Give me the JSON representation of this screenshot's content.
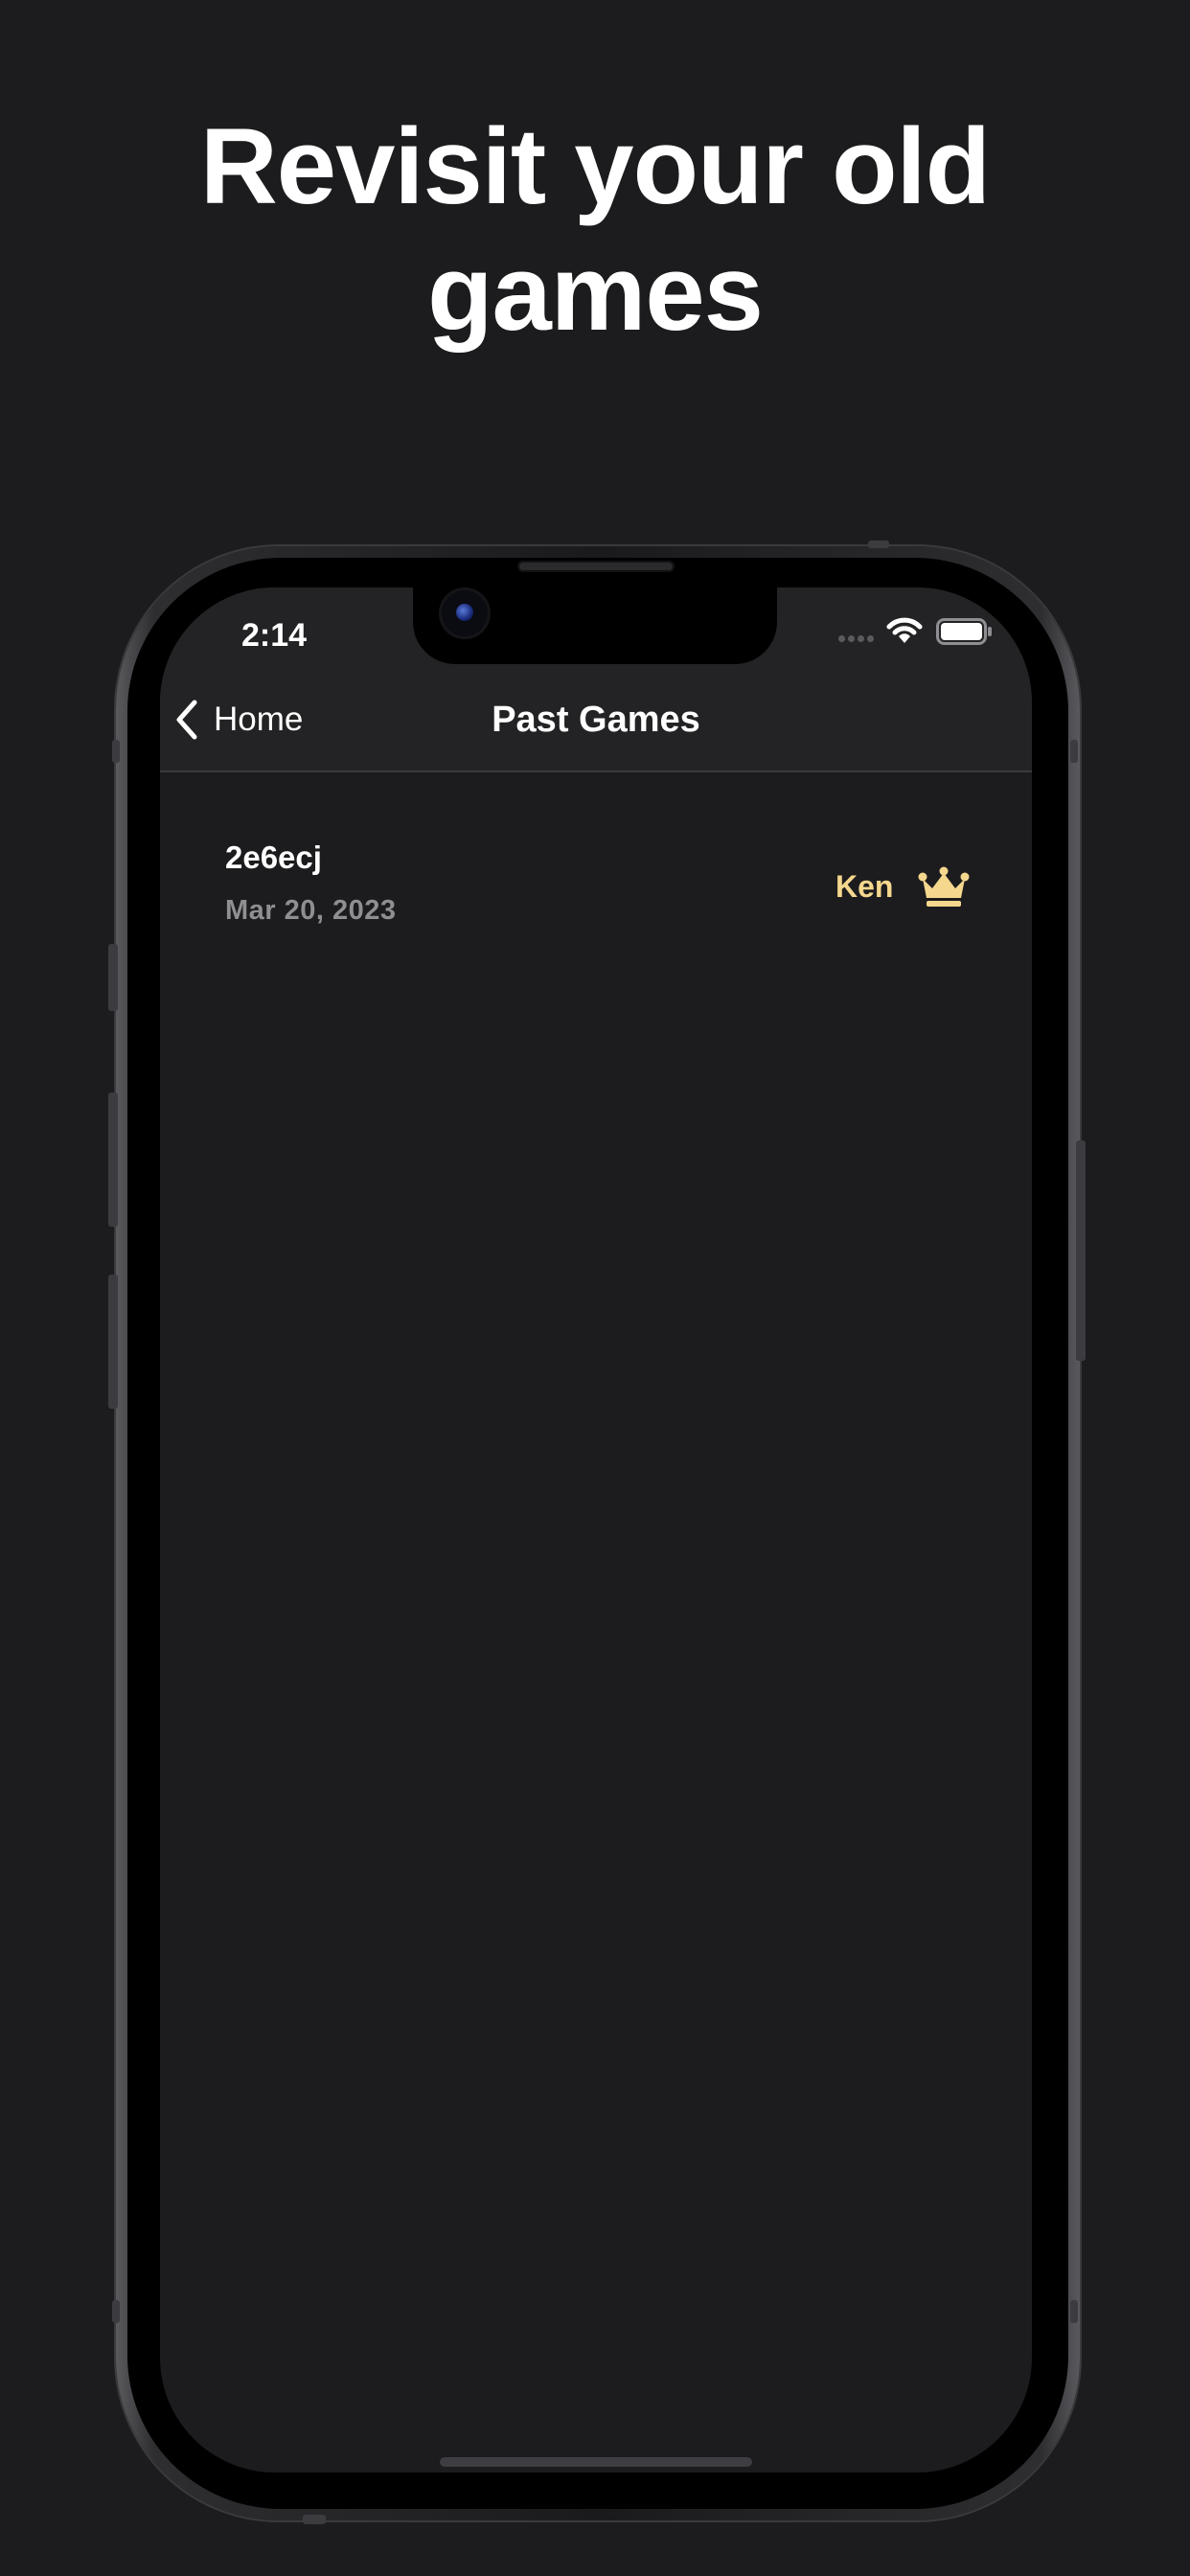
{
  "promo": {
    "headline_line1": "Revisit your old",
    "headline_line2": "games"
  },
  "status_bar": {
    "time": "2:14",
    "icons": [
      "cellular-signal-icon",
      "wifi-icon",
      "battery-icon"
    ]
  },
  "nav": {
    "back_label": "Home",
    "back_icon": "chevron-left-icon",
    "title": "Past Games"
  },
  "games": [
    {
      "code": "2e6ecj",
      "date": "Mar 20, 2023",
      "winner": "Ken",
      "winner_icon": "crown-icon"
    }
  ],
  "colors": {
    "background": "#1c1c1e",
    "nav_background": "#232325",
    "winner_accent": "#f5d78e",
    "secondary_text": "#8e8e93"
  }
}
